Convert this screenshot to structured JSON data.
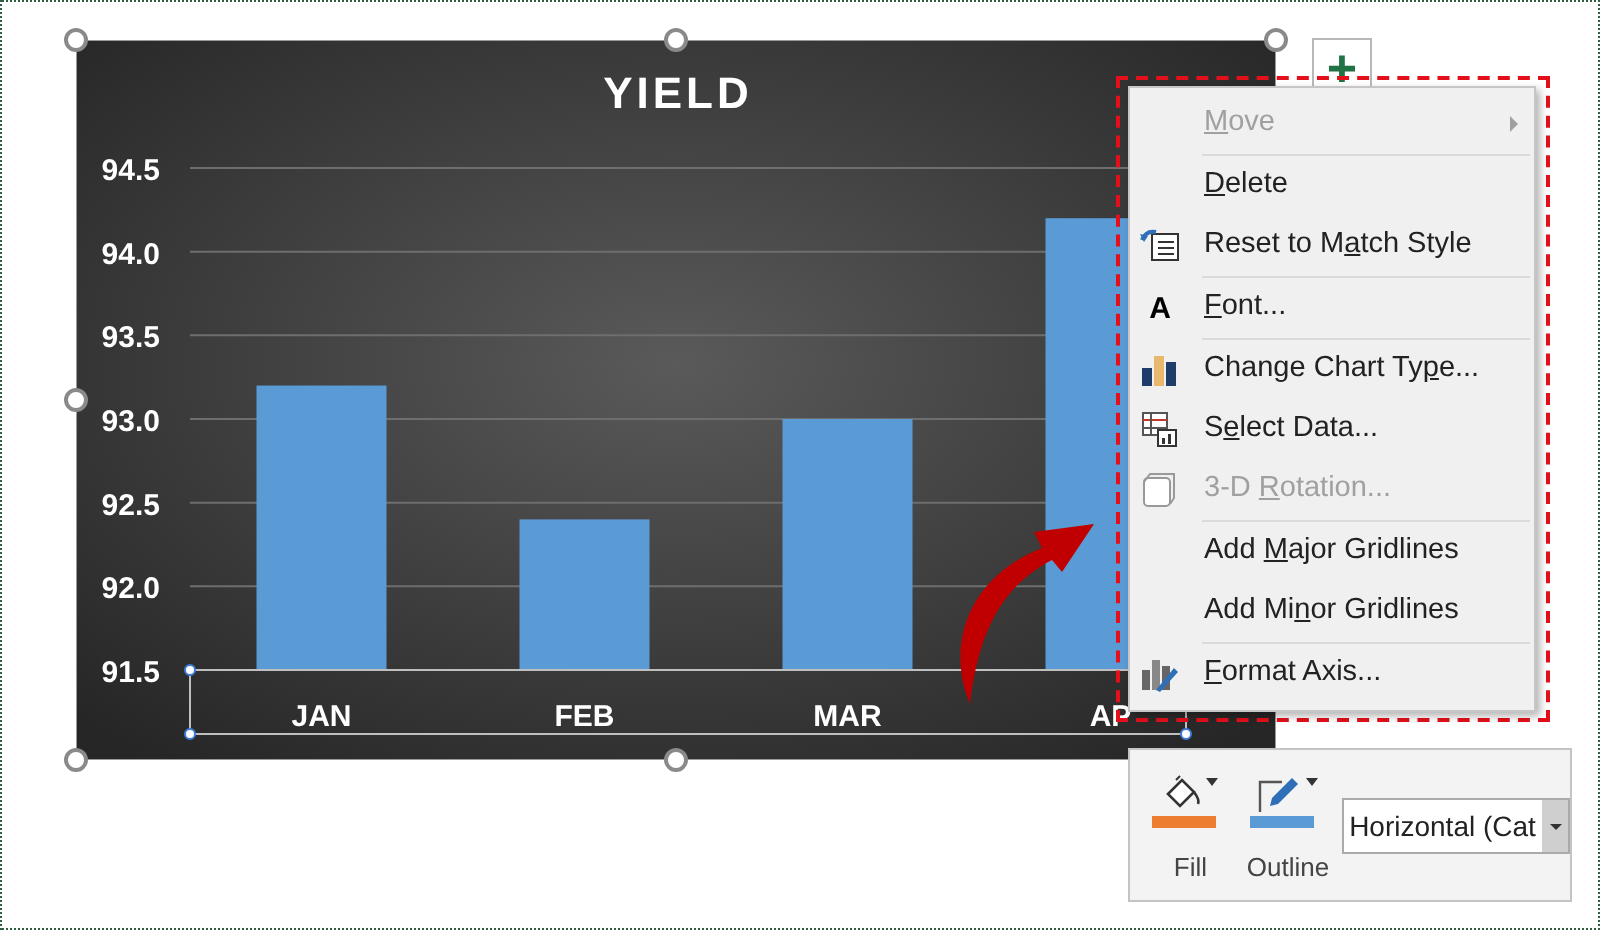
{
  "chart": {
    "chart_data": {
      "type": "bar",
      "title": "YIELD",
      "grid": true,
      "categories": [
        "JAN",
        "FEB",
        "MAR",
        "AP"
      ],
      "series": [
        {
          "color": "#5b9bd5",
          "values": [
            93.2,
            92.4,
            93.0,
            94.2
          ]
        }
      ],
      "ylim": [
        91.5,
        94.5
      ],
      "yticks": [
        {
          "value": 91.5,
          "label": "91.5"
        },
        {
          "value": 92,
          "label": "92.0"
        },
        {
          "value": 92.5,
          "label": "92.5"
        },
        {
          "value": 93,
          "label": "93.0"
        },
        {
          "value": 93.5,
          "label": "93.5"
        },
        {
          "value": 94,
          "label": "94.0"
        },
        {
          "value": 94.5,
          "label": "94.5"
        }
      ]
    }
  },
  "add_button": {
    "label": "+"
  },
  "context_menu": {
    "sections": [
      [
        {
          "key": "M",
          "after": "ove",
          "disabled": true,
          "submenu": true
        }
      ],
      [
        {
          "key": "D",
          "after": "elete",
          "disabled": false
        },
        {
          "kind": "reset",
          "before": "Reset to M",
          "key": "a",
          "after": "tch Style",
          "disabled": false
        }
      ],
      [
        {
          "kind": "font",
          "icon_text": "A",
          "key": "F",
          "after": "ont...",
          "disabled": false
        }
      ],
      [
        {
          "kind": "chart",
          "before": "Change Chart Ty",
          "key": "p",
          "after": "e...",
          "disabled": false
        },
        {
          "kind": "data",
          "before": "S",
          "key": "e",
          "after": "lect Data...",
          "disabled": false
        },
        {
          "kind": "cube",
          "before": "3-D ",
          "key": "R",
          "after": "otation...",
          "disabled": true
        }
      ],
      [
        {
          "before": "Add ",
          "key": "M",
          "after": "ajor Gridlines",
          "disabled": false
        },
        {
          "before": "Add Mi",
          "key": "n",
          "after": "or Gridlines",
          "disabled": false
        }
      ],
      [
        {
          "kind": "axis",
          "key": "F",
          "after": "ormat Axis...",
          "disabled": false
        }
      ]
    ]
  },
  "mini_toolbar": {
    "buttons": [
      {
        "kind": "fill",
        "label": "Fill",
        "color": "#ed7d31"
      },
      {
        "kind": "outline",
        "label": "Outline",
        "color": "#5b9bd5"
      }
    ],
    "dropdown": {
      "value": "Horizontal (Cat"
    }
  }
}
